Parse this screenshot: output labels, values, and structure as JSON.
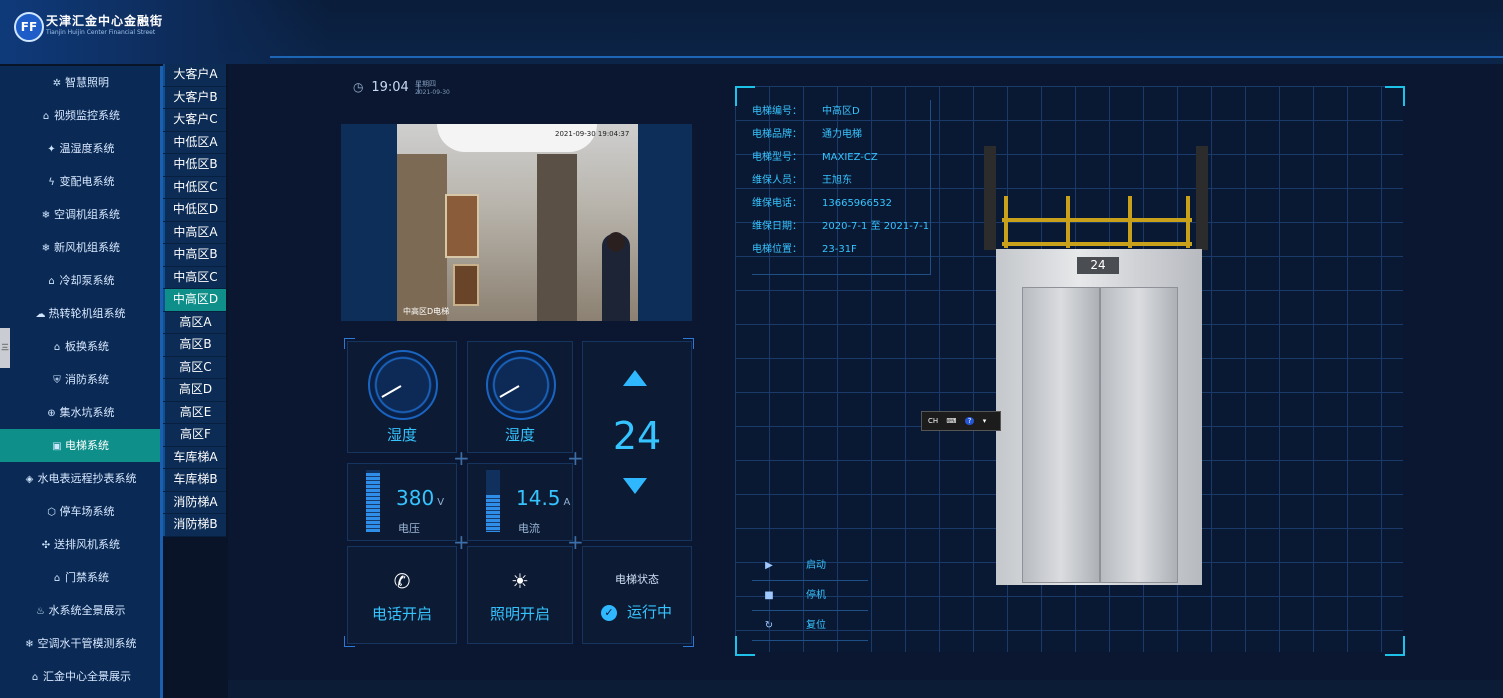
{
  "header": {
    "logo_text": "FF",
    "title": "天津汇金中心金融街",
    "subtitle": "Tianjin Huijin Center Financial Street"
  },
  "sidebar": {
    "items": [
      {
        "label": "智慧照明",
        "icon": "lightbulb-icon",
        "glyph": "✲"
      },
      {
        "label": "视频监控系统",
        "icon": "home-icon",
        "glyph": "⌂"
      },
      {
        "label": "温湿度系统",
        "icon": "thermometer-icon",
        "glyph": "✦"
      },
      {
        "label": "变配电系统",
        "icon": "power-icon",
        "glyph": "ϟ"
      },
      {
        "label": "空调机组系统",
        "icon": "snowflake-icon",
        "glyph": "❄"
      },
      {
        "label": "新风机组系统",
        "icon": "snowflake-icon",
        "glyph": "❄"
      },
      {
        "label": "冷却泵系统",
        "icon": "home-icon",
        "glyph": "⌂"
      },
      {
        "label": "热转轮机组系统",
        "icon": "cloud-icon",
        "glyph": "☁"
      },
      {
        "label": "板换系统",
        "icon": "home-icon",
        "glyph": "⌂"
      },
      {
        "label": "消防系统",
        "icon": "shield-icon",
        "glyph": "⛨"
      },
      {
        "label": "集水坑系统",
        "icon": "globe-icon",
        "glyph": "⊕"
      },
      {
        "label": "电梯系统",
        "icon": "elevator-icon",
        "glyph": "▣"
      },
      {
        "label": "水电表远程抄表系统",
        "icon": "layers-icon",
        "glyph": "◈"
      },
      {
        "label": "停车场系统",
        "icon": "tag-icon",
        "glyph": "⬡"
      },
      {
        "label": "送排风机系统",
        "icon": "fan-icon",
        "glyph": "✣"
      },
      {
        "label": "门禁系统",
        "icon": "home-icon",
        "glyph": "⌂"
      },
      {
        "label": "水系统全景展示",
        "icon": "drop-icon",
        "glyph": "♨"
      },
      {
        "label": "空调水干管模测系统",
        "icon": "snowflake-icon",
        "glyph": "❄"
      },
      {
        "label": "汇金中心全景展示",
        "icon": "home-icon",
        "glyph": "⌂"
      }
    ],
    "active_index": 11,
    "collapse_tab": "三"
  },
  "elevators": {
    "items": [
      "大客户A",
      "大客户B",
      "大客户C",
      "中低区A",
      "中低区B",
      "中低区C",
      "中低区D",
      "中高区A",
      "中高区B",
      "中高区C",
      "中高区D",
      "高区A",
      "高区B",
      "高区C",
      "高区D",
      "高区E",
      "高区F",
      "车库梯A",
      "车库梯B",
      "消防梯A",
      "消防梯B"
    ],
    "active_index": 10
  },
  "clock": {
    "time": "19:04",
    "separator": "|",
    "weekday": "星期四",
    "date": "2021-09-30"
  },
  "video": {
    "top_overlay": "2021-09-30 19:04:37",
    "caption": "中高区D电梯"
  },
  "gauges": [
    {
      "label": "湿度",
      "icon": "gauge-icon"
    },
    {
      "label": "湿度",
      "icon": "gauge-icon"
    }
  ],
  "meters": [
    {
      "value": "380",
      "unit": "V",
      "label": "电压",
      "fill": 0.95
    },
    {
      "value": "14.5",
      "unit": "A",
      "label": "电流",
      "fill": 0.6
    }
  ],
  "floor": {
    "current": "24",
    "up_icon": "arrow-up-icon",
    "down_icon": "arrow-down-icon"
  },
  "actions": [
    {
      "label": "电话开启",
      "icon": "phone-icon",
      "glyph": "✆"
    },
    {
      "label": "照明开启",
      "icon": "bulb-icon",
      "glyph": "☀"
    }
  ],
  "state": {
    "title": "电梯状态",
    "value": "运行中",
    "icon": "check-circle-icon"
  },
  "info": [
    {
      "key": "电梯编号：",
      "value": "中高区D"
    },
    {
      "key": "电梯品牌：",
      "value": "通力电梯"
    },
    {
      "key": "电梯型号：",
      "value": "MAXIEZ-CZ"
    },
    {
      "key": "维保人员：",
      "value": "王旭东"
    },
    {
      "key": "维保电话：",
      "value": "13665966532"
    },
    {
      "key": "维保日期：",
      "value": "2020-7-1 至 2021-7-1"
    },
    {
      "key": "电梯位置：",
      "value": "23-31F"
    }
  ],
  "car": {
    "floor": "24"
  },
  "ime_toolbar": {
    "text": "CH",
    "keyboard": "⌨",
    "help": "?"
  },
  "controls": [
    {
      "label": "启动",
      "icon": "play-icon",
      "glyph": "▶"
    },
    {
      "label": "停机",
      "icon": "stop-icon",
      "glyph": "■"
    },
    {
      "label": "复位",
      "icon": "reset-icon",
      "glyph": "↻"
    }
  ],
  "colors": {
    "accent": "#35c4ff",
    "active": "#0f8f8a",
    "panel": "#0c1a33"
  }
}
